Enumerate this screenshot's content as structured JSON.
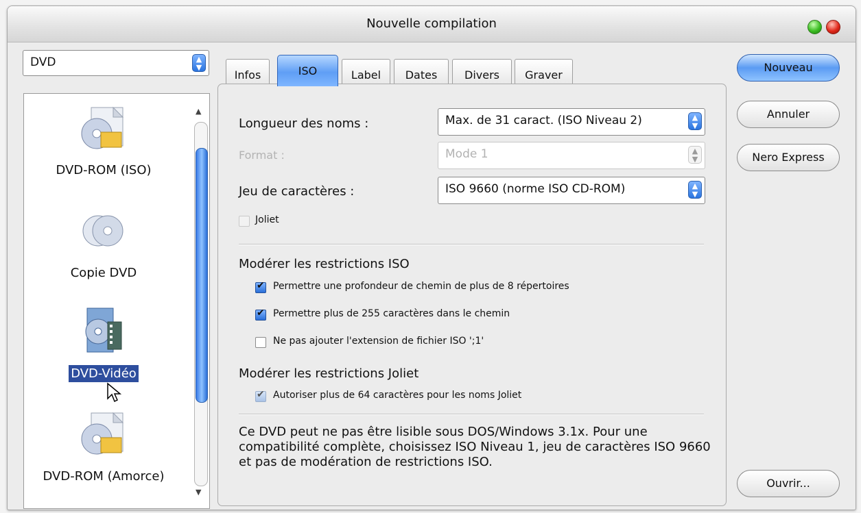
{
  "window": {
    "title": "Nouvelle compilation"
  },
  "sidebar": {
    "disc_type": "DVD",
    "items": [
      {
        "label": "DVD-ROM (ISO)",
        "icon": "dvd-rom-iso-icon",
        "selected": false
      },
      {
        "label": "Copie DVD",
        "icon": "copy-dvd-icon",
        "selected": false
      },
      {
        "label": "DVD-Vidéo",
        "icon": "dvd-video-icon",
        "selected": true
      },
      {
        "label": "DVD-ROM (Amorce)",
        "icon": "dvd-rom-boot-icon",
        "selected": false
      }
    ]
  },
  "tabs": [
    {
      "label": "Infos",
      "active": false
    },
    {
      "label": "ISO",
      "active": true
    },
    {
      "label": "Label",
      "active": false
    },
    {
      "label": "Dates",
      "active": false
    },
    {
      "label": "Divers",
      "active": false
    },
    {
      "label": "Graver",
      "active": false
    }
  ],
  "iso": {
    "name_length_label": "Longueur des noms :",
    "name_length_value": "Max. de 31 caract. (ISO Niveau 2)",
    "format_label": "Format :",
    "format_value": "Mode 1",
    "charset_label": "Jeu de caractères :",
    "charset_value": "ISO 9660 (norme ISO CD-ROM)",
    "joliet_label": "Joliet",
    "joliet_checked": false,
    "relax_iso_heading": "Modérer les restrictions ISO",
    "relax_iso_options": [
      {
        "label": "Permettre une profondeur de chemin de plus de 8 répertoires",
        "checked": true
      },
      {
        "label": "Permettre plus de 255 caractères dans le chemin",
        "checked": true
      },
      {
        "label": "Ne pas ajouter l'extension de fichier ISO ';1'",
        "checked": false
      }
    ],
    "relax_joliet_heading": "Modérer les restrictions Joliet",
    "relax_joliet_option": {
      "label": "Autoriser plus de 64 caractères pour les noms Joliet",
      "checked": true
    },
    "note": "Ce DVD peut ne pas être lisible sous DOS/Windows 3.1x. Pour une compatibilité complète, choisissez ISO Niveau 1, jeu de caractères ISO 9660 et pas de modération de restrictions ISO."
  },
  "buttons": {
    "new": "Nouveau",
    "cancel": "Annuler",
    "nero_express": "Nero Express",
    "open": "Ouvrir..."
  }
}
